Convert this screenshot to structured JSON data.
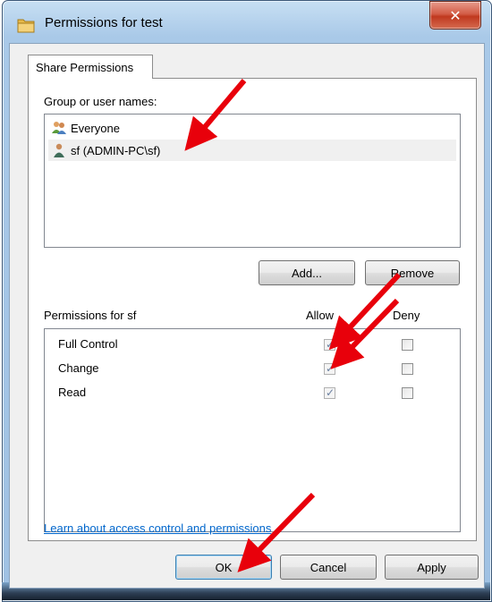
{
  "window": {
    "title": "Permissions for test",
    "close_glyph": "✕"
  },
  "tab": {
    "label": "Share Permissions"
  },
  "groups": {
    "label": "Group or user names:",
    "items": [
      {
        "name": "Everyone",
        "icon": "users-group-icon",
        "selected": false
      },
      {
        "name": "sf (ADMIN-PC\\sf)",
        "icon": "user-icon",
        "selected": true
      }
    ]
  },
  "buttons": {
    "add": "Add...",
    "remove": "Remove",
    "ok": "OK",
    "cancel": "Cancel",
    "apply": "Apply"
  },
  "permissions": {
    "label": "Permissions for sf",
    "allow_header": "Allow",
    "deny_header": "Deny",
    "rows": [
      {
        "name": "Full Control",
        "allow": true,
        "deny": false
      },
      {
        "name": "Change",
        "allow": true,
        "deny": false
      },
      {
        "name": "Read",
        "allow": true,
        "deny": false
      }
    ]
  },
  "link": {
    "text": "Learn about access control and permissions"
  },
  "colors": {
    "accent_link": "#0066cc",
    "annotation_arrow": "#e8000b",
    "close_button": "#c0391f"
  }
}
